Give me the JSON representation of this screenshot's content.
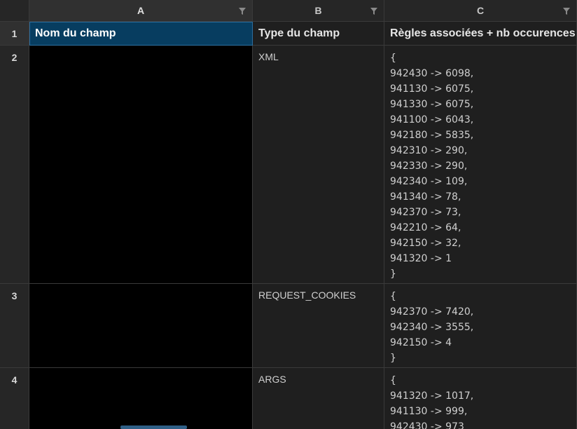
{
  "columns": [
    {
      "letter": "A"
    },
    {
      "letter": "B"
    },
    {
      "letter": "C"
    }
  ],
  "rows": [
    {
      "num": "1"
    },
    {
      "num": "2"
    },
    {
      "num": "3"
    },
    {
      "num": "4"
    }
  ],
  "header_row": {
    "col_a": "Nom du champ",
    "col_b": "Type du champ",
    "col_c": "Règles associées + nb occurences"
  },
  "data_rows": [
    {
      "type": "XML",
      "rules": [
        "{",
        "942430 -> 6098,",
        "941130 -> 6075,",
        "941330 -> 6075,",
        "941100 -> 6043,",
        "942180 -> 5835,",
        "942310 -> 290,",
        "942330 -> 290,",
        "942340 -> 109,",
        "941340 -> 78,",
        "942370 -> 73,",
        "942210 -> 64,",
        "942150 -> 32,",
        "941320 -> 1",
        "}"
      ]
    },
    {
      "type": "REQUEST_COOKIES",
      "rules": [
        "{",
        "942370 -> 7420,",
        "942340 -> 3555,",
        "942150 -> 4",
        "}"
      ]
    },
    {
      "type": "ARGS",
      "rules": [
        "{",
        "941320 -> 1017,",
        "941130 -> 999,",
        "942430 -> 973"
      ]
    }
  ],
  "colors": {
    "selected_cell": "#073d60",
    "background": "#1f1f1f",
    "redacted": "#000000"
  },
  "icons": {
    "filter": "filter-icon"
  }
}
